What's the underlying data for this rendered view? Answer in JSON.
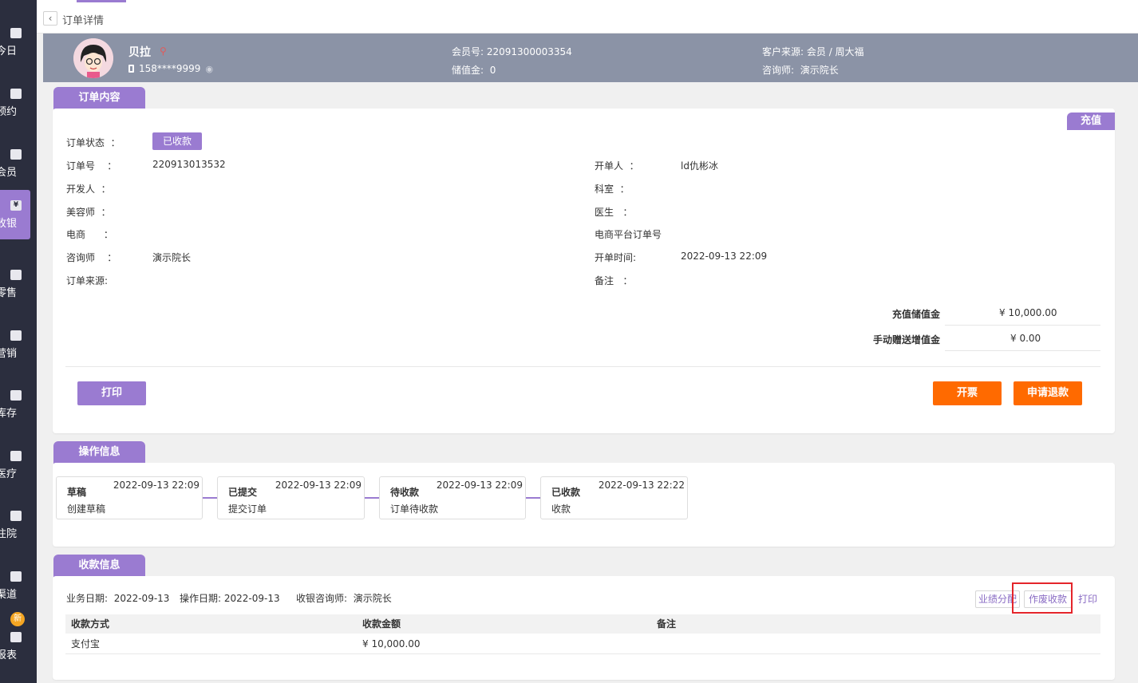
{
  "nav": {
    "items": [
      {
        "label": "今日",
        "icon": "chat-icon"
      },
      {
        "label": "预约",
        "icon": "calendar-check-icon"
      },
      {
        "label": "会员",
        "icon": "member-icon"
      },
      {
        "label": "收银",
        "icon": "yuan-icon"
      },
      {
        "label": "零售",
        "icon": "bag-icon"
      },
      {
        "label": "营销",
        "icon": "bookmark-icon"
      },
      {
        "label": "库存",
        "icon": "inventory-icon"
      },
      {
        "label": "医疗",
        "icon": "medical-kit-icon"
      },
      {
        "label": "住院",
        "icon": "hospital-icon"
      },
      {
        "label": "渠道",
        "icon": "channel-icon"
      },
      {
        "label": "报表",
        "icon": "report-icon"
      }
    ],
    "active_index": 3,
    "new_badge": "新",
    "yuan_glyph": "¥"
  },
  "breadcrumb": {
    "back": "‹",
    "title": "订单详情"
  },
  "member": {
    "name": "贝拉",
    "phone": "158****9999",
    "member_no_label": "会员号:",
    "member_no": "22091300003354",
    "stored_value_label": "储值金:",
    "stored_value": "0",
    "source_label": "客户来源:",
    "source": "会员 / 周大福",
    "consultant_label": "咨询师:",
    "consultant": "演示院长"
  },
  "order": {
    "tab": "订单内容",
    "type_tag": "充值",
    "status_label": "订单状态",
    "status": "已收款",
    "order_no_label": "订单号",
    "order_no": "220913013532",
    "developer_label": "开发人",
    "beautician_label": "美容师",
    "ecommerce_label": "电商",
    "consultant_label": "咨询师",
    "consultant": "演示院长",
    "source_label": "订单来源:",
    "creator_label": "开单人",
    "creator": "ld仇彬冰",
    "dept_label": "科室",
    "doctor_label": "医生",
    "platform_order_label": "电商平台订单号",
    "open_time_label": "开单时间:",
    "open_time": "2022-09-13 22:09",
    "remark_label": "备注",
    "colon": "：",
    "recharge_label": "充值储值金",
    "recharge_value": "¥ 10,000.00",
    "gift_label": "手动赠送增值金",
    "gift_value": "¥ 0.00",
    "print_btn": "打印",
    "invoice_btn": "开票",
    "refund_btn": "申请退款"
  },
  "operations": {
    "tab": "操作信息",
    "steps": [
      {
        "title": "草稿",
        "time": "2022-09-13 22:09",
        "desc": "创建草稿"
      },
      {
        "title": "已提交",
        "time": "2022-09-13 22:09",
        "desc": "提交订单"
      },
      {
        "title": "待收款",
        "time": "2022-09-13 22:09",
        "desc": "订单待收款"
      },
      {
        "title": "已收款",
        "time": "2022-09-13 22:22",
        "desc": "收款"
      }
    ]
  },
  "payment": {
    "tab": "收款信息",
    "biz_date_label": "业务日期:",
    "biz_date": "2022-09-13",
    "op_date_label": "操作日期:",
    "op_date": "2022-09-13",
    "cashier_label": "收银咨询师:",
    "cashier": "演示院长",
    "btn_allocate": "业绩分配",
    "btn_void": "作废收款",
    "btn_print": "打印",
    "columns": [
      "收款方式",
      "收款金额",
      "备注"
    ],
    "rows": [
      [
        "支付宝",
        "¥ 10,000.00",
        ""
      ]
    ]
  }
}
